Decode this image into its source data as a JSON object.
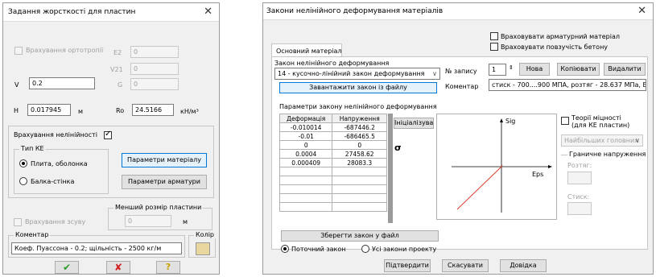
{
  "left": {
    "title": "Задання жорсткості для пластин",
    "orthotropy_label": "Врахування ортотропії",
    "e2_label": "E2",
    "e2_value": "0",
    "v21_label": "V21",
    "v21_value": "0",
    "g_label": "G",
    "g_value": "0",
    "v_label": "V",
    "v_value": "0.2",
    "h_label": "H",
    "h_value": "0.017945",
    "h_unit": "м",
    "ro_label": "Ro",
    "ro_value": "24.5166",
    "ro_unit": "кН/м³",
    "nonlinearity_label": "Врахування нелінійності",
    "fe_type_group": "Тип КЕ",
    "radio_plate": "Плита, оболонка",
    "radio_beam": "Балка-стінка",
    "material_params_button": "Параметри матеріалу",
    "rebar_params_button": "Параметри арматури",
    "min_size_group": "Менший розмір пластини",
    "min_size_value": "0",
    "min_size_unit": "м",
    "shear_label": "Врахування зсуву",
    "comment_label": "Коментар",
    "color_label": "Колір",
    "comment_value": "Коеф. Пуассона - 0.2; щільність - 2500 кг/м",
    "color_swatch": "#e8d8a0",
    "ok_icon": "check-icon",
    "cancel_icon": "cross-icon",
    "help_icon": "question-icon",
    "ok_color": "#2e9c2e",
    "cancel_color": "#d42020",
    "help_color": "#c8a000"
  },
  "right": {
    "title": "Закони нелінійного деформування матеріалів",
    "rebar_material_label": "Враховувати арматурний матеріал",
    "concrete_creep_label": "Враховувати повзучість бетону",
    "tab_label": "Основний матеріал",
    "law_label": "Закон нелінійного деформування",
    "law_value": "14 - кусочно-лінійний закон деформування",
    "load_law_button": "Завантажити закон із файлу",
    "record_label": "№ запису",
    "record_value": "1",
    "new_button": "Нова",
    "copy_button": "Копіювати",
    "delete_button": "Видалити",
    "comment_label": "Коментар",
    "comment_value": "стиск - 700....900 МПА, розтяг - 28.637 МПа, E=70(",
    "params_label": "Параметри закону нелінійного деформування",
    "table_headers": [
      "Деформація",
      "Напруження"
    ],
    "table_rows": [
      [
        "-0.010014",
        "-687446.2"
      ],
      [
        "-0.01",
        "-686465.5"
      ],
      [
        "0",
        "0"
      ],
      [
        "0.0004",
        "27458.62"
      ],
      [
        "0.000409",
        "28083.3"
      ]
    ],
    "init_button": "Ініціалізувати",
    "sigma_label": "σ",
    "graph_y_label": "Sig",
    "graph_x_label": "Eps",
    "graph_line_color": "#e04030",
    "strength_theory_label_1": "Теорії міцності",
    "strength_theory_label_2": "(для КЕ пластин)",
    "strength_theory_value": "Найбільших головних",
    "limit_stress_group": "Граничне напруження",
    "tension_label": "Розтяг:",
    "compression_label": "Стиск:",
    "save_law_button": "Зберегти закон у файл",
    "radio_current": "Поточний закон",
    "radio_all": "Усі закони проекту",
    "confirm_button": "Підтвердити",
    "cancel_button": "Скасувати",
    "help_button": "Довідка"
  }
}
